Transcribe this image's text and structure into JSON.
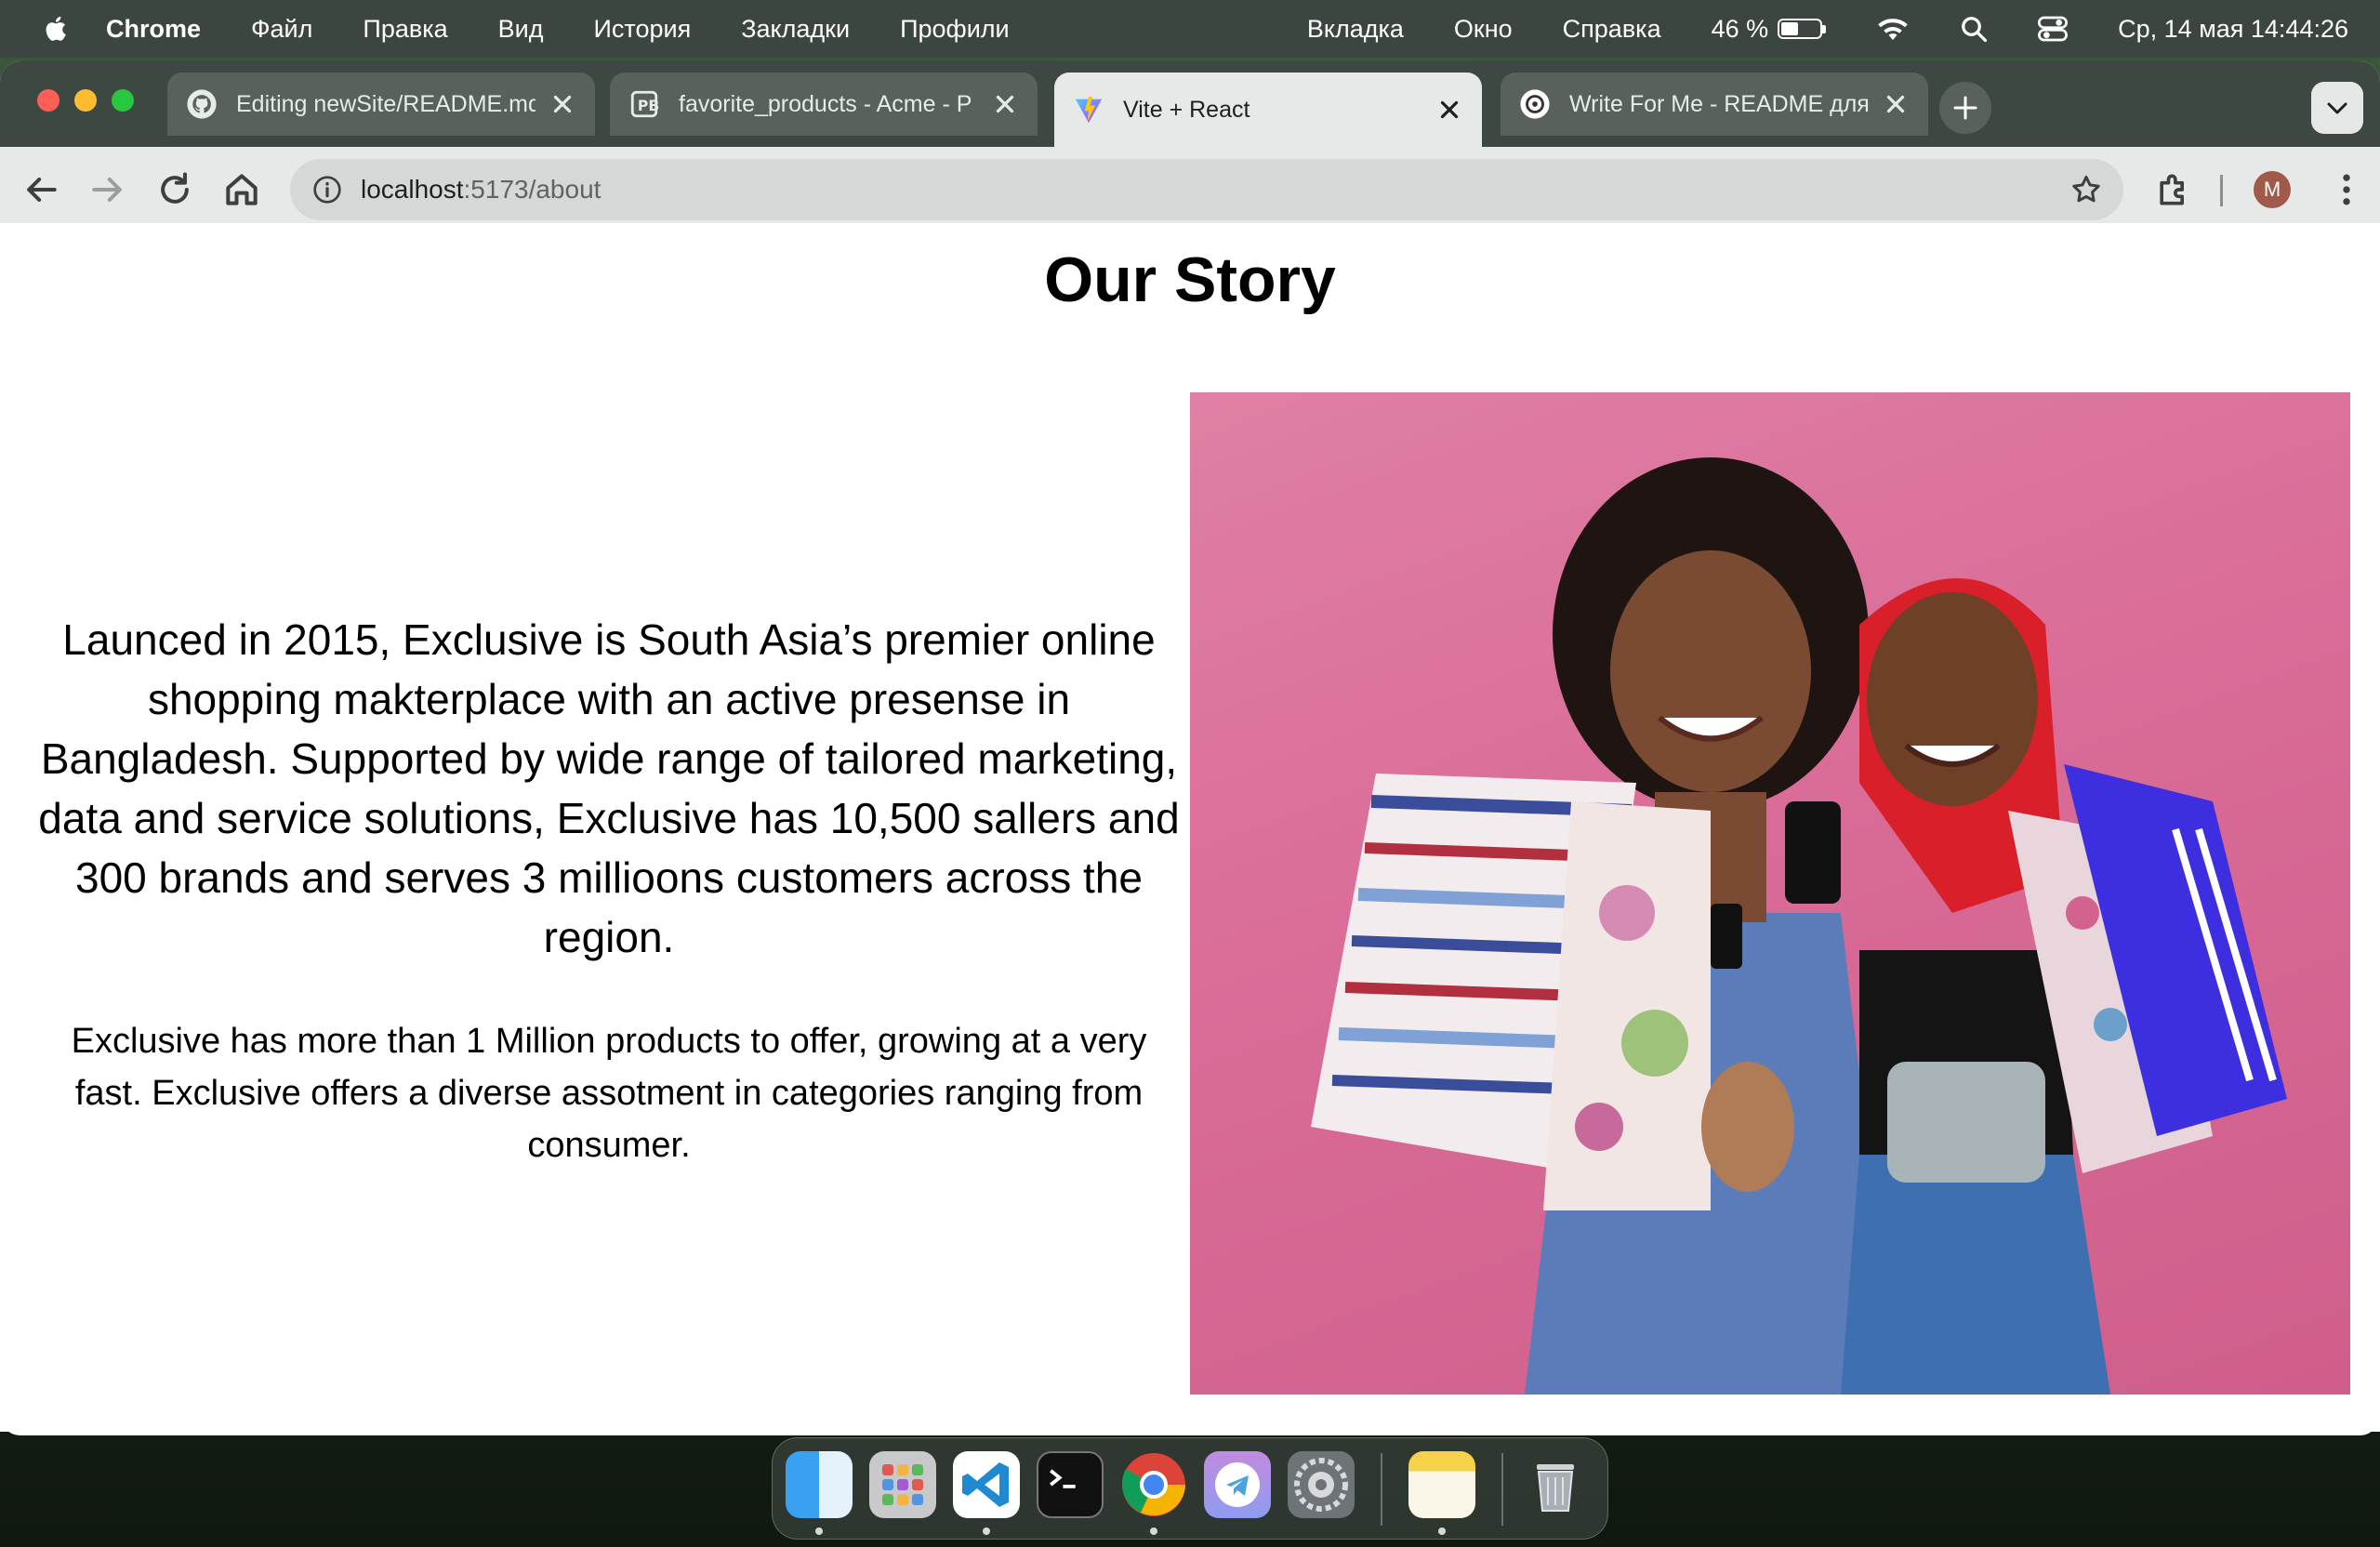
{
  "menubar": {
    "app_name": "Chrome",
    "items": [
      "Файл",
      "Правка",
      "Вид",
      "История",
      "Закладки",
      "Профили"
    ],
    "right_items": [
      "Вкладка",
      "Окно",
      "Справка"
    ],
    "battery_percent": "46 %",
    "battery_level": 0.46,
    "datetime": "Ср, 14 мая  14:44:26"
  },
  "tabs": [
    {
      "title": "Editing newSite/README.md",
      "icon": "github-icon",
      "active": false
    },
    {
      "title": "favorite_products - Acme - P",
      "icon": "pocketbase-icon",
      "active": false
    },
    {
      "title": "Vite + React",
      "icon": "vite-icon",
      "active": true
    },
    {
      "title": "Write For Me - README для г",
      "icon": "chatgpt-icon",
      "active": false
    }
  ],
  "address_bar": {
    "host": "localhost",
    "path": ":5173/about"
  },
  "profile": {
    "initial": "M"
  },
  "page": {
    "title": "Our Story",
    "paragraph_lead": "Launced in 2015, Exclusive is South Asia’s premier online shopping makterplace with an active presense in Bangladesh. Supported by wide range of tailored marketing, data and service solutions, Exclusive has 10,500 sallers and 300 brands and serves 3 millioons customers across the region.",
    "paragraph_body": "Exclusive has more than 1 Million products to offer, growing at a very fast. Exclusive offers a diverse assotment in categories ranging from consumer."
  },
  "dock": {
    "apps": [
      "finder-icon",
      "launchpad-icon",
      "vscode-icon",
      "terminal-icon",
      "chrome-icon",
      "telegram-icon",
      "system-settings-icon",
      "notes-icon",
      "trash-icon"
    ]
  },
  "colors": {
    "hero_bg": "#d86a96",
    "tab_active": "#e7e9e8",
    "tabstrip": "#3e4842"
  }
}
